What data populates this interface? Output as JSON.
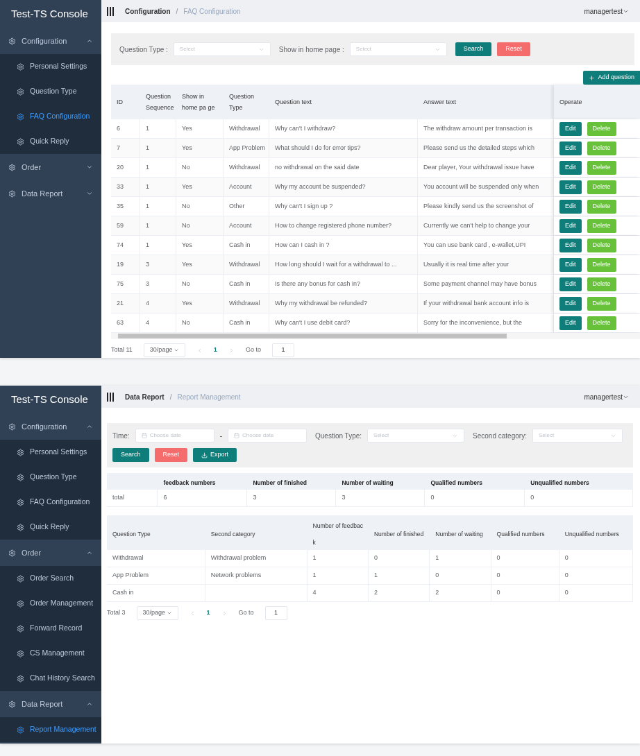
{
  "panels": [
    {
      "kind": "faq",
      "sidebar": {
        "title": "Test-TS Console",
        "groups": [
          {
            "label": "Configuration",
            "expanded": true,
            "items": [
              {
                "label": "Personal Settings",
                "selected": false
              },
              {
                "label": "Question Type",
                "selected": false
              },
              {
                "label": "FAQ Configuration",
                "selected": true
              },
              {
                "label": "Quick Reply",
                "selected": false
              }
            ]
          },
          {
            "label": "Order",
            "expanded": false
          },
          {
            "label": "Data Report",
            "expanded": false
          }
        ]
      },
      "header": {
        "breadcrumb": [
          "Configuration",
          "FAQ Configuration"
        ],
        "separator": "/",
        "user": "managertest"
      },
      "filters": [
        {
          "label": "Question Type :",
          "placeholder": "Select"
        },
        {
          "label": "Show in home page :",
          "placeholder": "Select"
        }
      ],
      "buttons": [
        {
          "label": "Search",
          "kind": "primary"
        },
        {
          "label": "Reset",
          "kind": "danger"
        }
      ],
      "add_button": "Add question",
      "table": {
        "columns": [
          "ID",
          "Question Sequence",
          "Show in home pa ge",
          "Question Type",
          "Question text",
          "Answer text",
          "Operate"
        ],
        "rows": [
          {
            "cells": [
              "6",
              "1",
              "Yes",
              "Withdrawal",
              "Why can't I withdraw?",
              "The withdraw amount per transaction is"
            ],
            "actions": [
              "Edit",
              "Delete"
            ]
          },
          {
            "cells": [
              "7",
              "1",
              "Yes",
              "App Problem",
              "What should I do for error tips?",
              "Please send us the detailed steps which"
            ],
            "actions": [
              "Edit",
              "Delete"
            ]
          },
          {
            "cells": [
              "20",
              "1",
              "No",
              "Withdrawal",
              "no withdrawal on the said date",
              "Dear player, Your withdrawal issue have"
            ],
            "actions": [
              "Edit",
              "Delete"
            ]
          },
          {
            "cells": [
              "33",
              "1",
              "Yes",
              "Account",
              "Why my account be suspended?",
              "You account will be suspended only when"
            ],
            "actions": [
              "Edit",
              "Delete"
            ]
          },
          {
            "cells": [
              "35",
              "1",
              "No",
              "Other",
              "Why can't I sign up ?",
              "Please kindly send us the screenshot of"
            ],
            "actions": [
              "Edit",
              "Delete"
            ]
          },
          {
            "cells": [
              "59",
              "1",
              "No",
              "Account",
              "How to change registered phone number?",
              "Currently we can't help to change your"
            ],
            "actions": [
              "Edit",
              "Delete"
            ]
          },
          {
            "cells": [
              "74",
              "1",
              "Yes",
              "Cash in",
              "How can I cash in ?",
              "You can use bank card , e-wallet,UPI"
            ],
            "actions": [
              "Edit",
              "Delete"
            ]
          },
          {
            "cells": [
              "19",
              "3",
              "Yes",
              "Withdrawal",
              "How long should I wait for a withdrawal to ...",
              "Usually it is real time after your"
            ],
            "actions": [
              "Edit",
              "Delete"
            ]
          },
          {
            "cells": [
              "75",
              "3",
              "No",
              "Cash in",
              "Is there any bonus for cash in?",
              "Some payment channel may have bonus"
            ],
            "actions": [
              "Edit",
              "Delete"
            ]
          },
          {
            "cells": [
              "21",
              "4",
              "Yes",
              "Withdrawal",
              "Why my withdrawal be refunded?",
              "If your withdrawal bank account info is"
            ],
            "actions": [
              "Edit",
              "Delete"
            ]
          },
          {
            "cells": [
              "63",
              "4",
              "No",
              "Cash in",
              "Why can't I use debit card?",
              "Sorry for the inconvenience, but the"
            ],
            "actions": [
              "Edit",
              "Delete"
            ]
          }
        ]
      },
      "pagination": {
        "total": "Total 11",
        "page_size": "30/page",
        "pages": [
          {
            "label": "1",
            "selected": true
          }
        ],
        "goto_label": "Go to",
        "goto_value": "1"
      }
    },
    {
      "kind": "report",
      "sidebar": {
        "title": "Test-TS Console",
        "groups": [
          {
            "label": "Configuration",
            "expanded": true,
            "items": [
              {
                "label": "Personal Settings",
                "selected": false
              },
              {
                "label": "Question Type",
                "selected": false
              },
              {
                "label": "FAQ Configuration",
                "selected": false
              },
              {
                "label": "Quick Reply",
                "selected": false
              }
            ]
          },
          {
            "label": "Order",
            "expanded": true,
            "items": [
              {
                "label": "Order Search",
                "selected": false
              },
              {
                "label": "Order Management",
                "selected": false
              },
              {
                "label": "Forward Record",
                "selected": false
              },
              {
                "label": "CS Management",
                "selected": false
              },
              {
                "label": "Chat History Search",
                "selected": false
              }
            ]
          },
          {
            "label": "Data Report",
            "expanded": true,
            "items": [
              {
                "label": "Report Management",
                "selected": true
              }
            ]
          }
        ]
      },
      "header": {
        "breadcrumb": [
          "Data Report",
          "Report Management"
        ],
        "separator": "/",
        "user": "managertest"
      },
      "time": {
        "label": "Time:",
        "placeholders": [
          "Choose date",
          "Choose date"
        ],
        "separator": "-"
      },
      "filters": [
        {
          "label": "Question Type:",
          "placeholder": "Select"
        },
        {
          "label": "Second category:",
          "placeholder": "Select"
        }
      ],
      "buttons": [
        {
          "label": "Search",
          "kind": "primary"
        },
        {
          "label": "Reset",
          "kind": "danger"
        },
        {
          "label": "Export",
          "kind": "export"
        }
      ],
      "summary": {
        "columns": [
          "",
          "feedback numbers",
          "Number of finished",
          "Number of waiting",
          "Qualified numbers",
          "Unqualified numbers"
        ],
        "rows": [
          [
            "total",
            "6",
            "3",
            "3",
            "0",
            "0"
          ]
        ]
      },
      "table": {
        "columns": [
          "Question Type",
          "Second category",
          "Number of feedbac k",
          "Number of finished",
          "Number of waiting",
          "Qualified numbers",
          "Unqualified numbers"
        ],
        "rows": [
          [
            "Withdrawal",
            "Withdrawal problem",
            "1",
            "0",
            "1",
            "0",
            "0"
          ],
          [
            "App Problem",
            "Network problems",
            "1",
            "1",
            "0",
            "0",
            "0"
          ],
          [
            "Cash in",
            null,
            "4",
            "2",
            "2",
            "0",
            "0"
          ]
        ]
      },
      "pagination": {
        "total": "Total 3",
        "page_size": "30/page",
        "pages": [
          {
            "label": "1",
            "selected": true
          }
        ],
        "goto_label": "Go to",
        "goto_value": "1"
      }
    }
  ]
}
